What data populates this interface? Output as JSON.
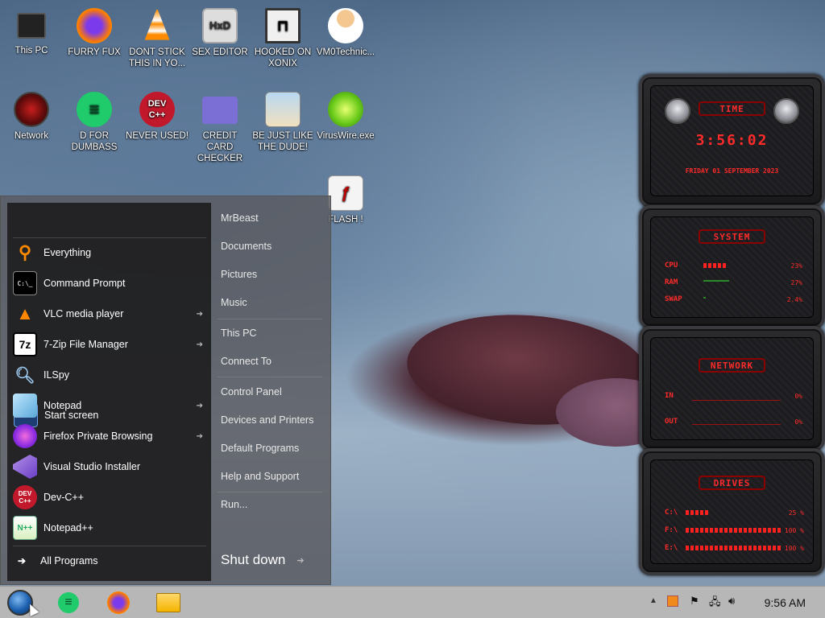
{
  "desktop_icons": [
    {
      "label": "This PC",
      "icon": "monitor-icon"
    },
    {
      "label": "FURRY FUX",
      "icon": "firefox-icon"
    },
    {
      "label": "DONT STICK THIS IN YO...",
      "icon": "vlc-cone-icon"
    },
    {
      "label": "SEX EDITOR",
      "icon": "hxd-icon"
    },
    {
      "label": "HOOKED ON XONIX",
      "icon": "xonix-icon"
    },
    {
      "label": "VM0Technic...",
      "icon": "doctor-icon"
    },
    {
      "label": "Network",
      "icon": "network-icon"
    },
    {
      "label": "D FOR DUMBASS",
      "icon": "green-chat-icon"
    },
    {
      "label": "NEVER USED!",
      "icon": "devcpp-icon"
    },
    {
      "label": "CREDIT CARD CHECKER",
      "icon": "credit-card-icon"
    },
    {
      "label": "BE JUST LIKE THE DUDE!",
      "icon": "dude-icon"
    },
    {
      "label": "VirusWire.exe",
      "icon": "lime-icon"
    },
    {
      "label": "FLASH !",
      "icon": "flash-icon"
    }
  ],
  "start_menu": {
    "left_items": [
      {
        "label": "Start screen",
        "icon": "start-screen-icon",
        "has_submenu": false
      },
      {
        "label": "Everything",
        "icon": "magnifier-icon",
        "has_submenu": false
      },
      {
        "label": "Command Prompt",
        "icon": "cmd-icon",
        "has_submenu": false
      },
      {
        "label": "VLC media player",
        "icon": "vlc-icon",
        "has_submenu": true
      },
      {
        "label": "7-Zip File Manager",
        "icon": "7zip-icon",
        "has_submenu": true
      },
      {
        "label": "ILSpy",
        "icon": "ilspy-icon",
        "has_submenu": false
      },
      {
        "label": "Notepad",
        "icon": "notepad-icon",
        "has_submenu": true
      },
      {
        "label": "Firefox Private Browsing",
        "icon": "firefox-private-icon",
        "has_submenu": true
      },
      {
        "label": "Visual Studio Installer",
        "icon": "visual-studio-icon",
        "has_submenu": false
      },
      {
        "label": "Dev-C++",
        "icon": "devcpp-icon",
        "has_submenu": false
      },
      {
        "label": "Notepad++",
        "icon": "notepadpp-icon",
        "has_submenu": false
      }
    ],
    "all_programs": "All Programs",
    "right_items": [
      "MrBeast",
      "Documents",
      "Pictures",
      "Music",
      "This PC",
      "Connect To",
      "Control Panel",
      "Devices and Printers",
      "Default Programs",
      "Help and Support",
      "Run..."
    ],
    "shutdown": "Shut down"
  },
  "taskbar": {
    "clock": "9:56 AM",
    "pinned": [
      "start-orb-icon",
      "green-chat-icon",
      "firefox-icon",
      "file-explorer-icon"
    ]
  },
  "widgets": {
    "time": {
      "title": "TIME",
      "clock": "3:56:02",
      "date": "FRIDAY 01 SEPTEMBER 2023"
    },
    "system": {
      "title": "SYSTEM",
      "rows": [
        {
          "label": "CPU",
          "value": "23%",
          "level": 0.23
        },
        {
          "label": "RAM",
          "value": "27%",
          "level": 0.27
        },
        {
          "label": "SWAP",
          "value": "2.4%",
          "level": 0.024
        }
      ]
    },
    "network": {
      "title": "NETWORK",
      "rows": [
        {
          "label": "IN",
          "value": "0%"
        },
        {
          "label": "OUT",
          "value": "0%"
        }
      ]
    },
    "drives": {
      "title": "DRIVES",
      "rows": [
        {
          "label": "C:\\",
          "value": "25 %",
          "level": 0.25
        },
        {
          "label": "F:\\",
          "value": "100 %",
          "level": 1.0
        },
        {
          "label": "E:\\",
          "value": "100 %",
          "level": 1.0
        }
      ]
    }
  },
  "colors": {
    "accent_red": "#ff2a2a",
    "taskbar": "#b7b7b7",
    "start_bg": "#1e1e20"
  }
}
